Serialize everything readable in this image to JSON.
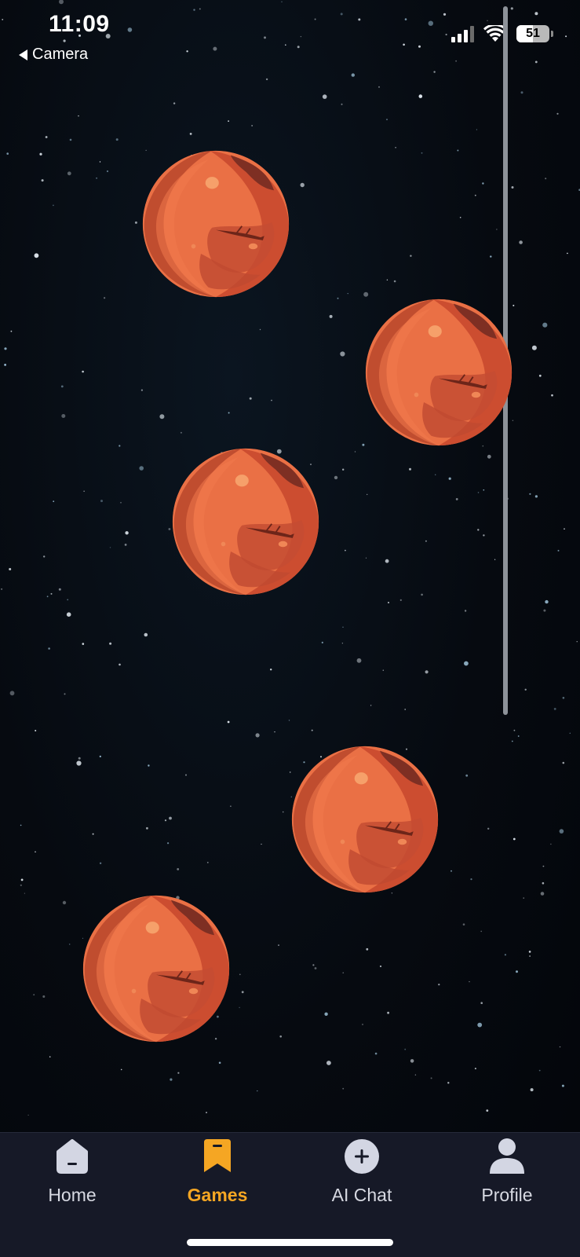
{
  "status_bar": {
    "time": "11:09",
    "back_label": "Camera",
    "battery": "51",
    "battery_level": 0.51
  },
  "game": {
    "planet_icon": "mars-planet-icon",
    "planet_count": 5
  },
  "tabbar": {
    "tabs": [
      {
        "label": "Home",
        "icon": "home-icon",
        "active": false
      },
      {
        "label": "Games",
        "icon": "bookmark-icon",
        "active": true
      },
      {
        "label": "AI Chat",
        "icon": "plus-circle-icon",
        "active": false
      },
      {
        "label": "Profile",
        "icon": "person-icon",
        "active": false
      }
    ],
    "active_color": "#f5a623",
    "inactive_color": "#d7d9e2"
  }
}
